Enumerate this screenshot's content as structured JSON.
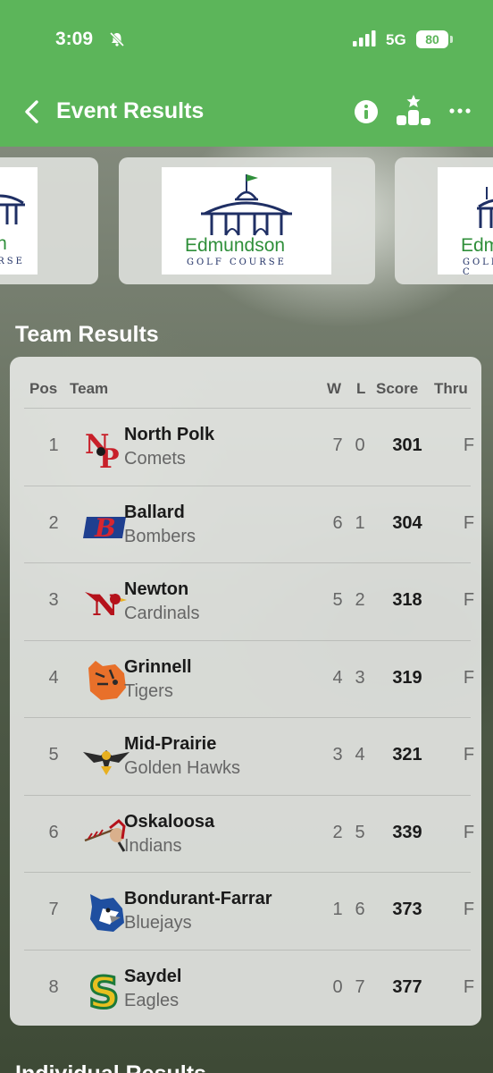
{
  "status_bar": {
    "time": "3:09",
    "network": "5G",
    "battery": "80"
  },
  "nav": {
    "title": "Event Results",
    "icons": [
      "back-chevron-icon",
      "info-icon",
      "podium-icon",
      "more-icon"
    ]
  },
  "course_logo": {
    "name": "Edmundson",
    "subtitle": "GOLF COURSE",
    "partial_name": "Edm",
    "partial_subtitle": "GOLF C",
    "left_partial_name": "son",
    "left_partial_subtitle": "COURSE"
  },
  "team_results": {
    "title": "Team Results",
    "headers": {
      "pos": "Pos",
      "team": "Team",
      "w": "W",
      "l": "L",
      "score": "Score",
      "thru": "Thru"
    },
    "rows": [
      {
        "pos": "1",
        "team": "North Polk",
        "mascot": "Comets",
        "w": "7",
        "l": "0",
        "score": "301",
        "thru": "F",
        "logo": "np-logo-icon",
        "color": "#c8202a"
      },
      {
        "pos": "2",
        "team": "Ballard",
        "mascot": "Bombers",
        "w": "6",
        "l": "1",
        "score": "304",
        "thru": "F",
        "logo": "ballard-b-logo-icon",
        "color": "#d7262f"
      },
      {
        "pos": "3",
        "team": "Newton",
        "mascot": "Cardinals",
        "w": "5",
        "l": "2",
        "score": "318",
        "thru": "F",
        "logo": "newton-cardinal-logo-icon",
        "color": "#b5121b"
      },
      {
        "pos": "4",
        "team": "Grinnell",
        "mascot": "Tigers",
        "w": "4",
        "l": "3",
        "score": "319",
        "thru": "F",
        "logo": "tiger-logo-icon",
        "color": "#e8702a"
      },
      {
        "pos": "5",
        "team": "Mid-Prairie",
        "mascot": "Golden Hawks",
        "w": "3",
        "l": "4",
        "score": "321",
        "thru": "F",
        "logo": "hawk-logo-icon",
        "color": "#2b2b2b"
      },
      {
        "pos": "6",
        "team": "Oskaloosa",
        "mascot": "Indians",
        "w": "2",
        "l": "5",
        "score": "339",
        "thru": "F",
        "logo": "oskaloosa-logo-icon",
        "color": "#b5121b"
      },
      {
        "pos": "7",
        "team": "Bondurant-Farrar",
        "mascot": "Bluejays",
        "w": "1",
        "l": "6",
        "score": "373",
        "thru": "F",
        "logo": "bluejay-logo-icon",
        "color": "#1f4fa0"
      },
      {
        "pos": "8",
        "team": "Saydel",
        "mascot": "Eagles",
        "w": "0",
        "l": "7",
        "score": "377",
        "thru": "F",
        "logo": "saydel-s-logo-icon",
        "color": "#1c7a3a"
      }
    ]
  },
  "next_section_title": "Individual Results"
}
